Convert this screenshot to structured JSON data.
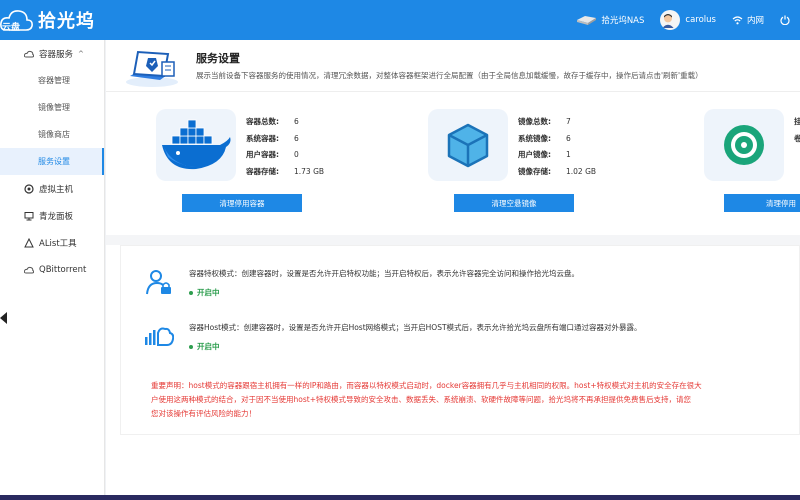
{
  "app": {
    "logo_badge": "云盘",
    "logo_name": "拾光坞"
  },
  "topbar": {
    "device_name": "拾光坞NAS",
    "user_name": "carolus",
    "network": "内网",
    "power_icon": "power-icon"
  },
  "sidebar": {
    "group_label": "容器服务",
    "sub_items": [
      "容器管理",
      "镜像管理",
      "镜像商店",
      "服务设置"
    ],
    "active_index": 3,
    "items": [
      "虚拟主机",
      "青龙面板",
      "AList工具",
      "QBittorrent"
    ]
  },
  "header": {
    "title": "服务设置",
    "description": "展示当前设备下容器服务的使用情况，清理冗余数据，对整体容器框架进行全局配置（由于全局信息加载缓慢，故存于缓存中，操作后请点击'刷新'重载）"
  },
  "stats": {
    "containers": {
      "rows": [
        {
          "label": "容器总数:",
          "value": "6"
        },
        {
          "label": "系统容器:",
          "value": "6"
        },
        {
          "label": "用户容器:",
          "value": "0"
        },
        {
          "label": "容器存储:",
          "value": "1.73 GB"
        }
      ],
      "button": "清理停用容器"
    },
    "images": {
      "rows": [
        {
          "label": "镜像总数:",
          "value": "7"
        },
        {
          "label": "系统镜像:",
          "value": "6"
        },
        {
          "label": "用户镜像:",
          "value": "1"
        },
        {
          "label": "镜像存储:",
          "value": "1.02 GB"
        }
      ],
      "button": "清理空悬镜像"
    },
    "volumes": {
      "rows": [
        {
          "label": "挂",
          "value": ""
        },
        {
          "label": "卷",
          "value": ""
        }
      ],
      "button": "清理停用"
    }
  },
  "modes": {
    "privileged": {
      "text": "容器特权模式：创建容器时，设置是否允许开启特权功能；当开启特权后，表示允许容器完全访问和操作拾光坞云盘。",
      "status": "开启中"
    },
    "host": {
      "text": "容器Host模式：创建容器时，设置是否允许开启Host网络模式；当开启HOST模式后，表示允许拾光坞云盘所有端口通过容器对外暴露。",
      "status": "开启中"
    },
    "warning_lines": [
      "重要声明：host模式的容器跟宿主机拥有一样的IP和路由，而容器以特权模式启动时，docker容器拥有几乎与主机相同的权限。host+特权模式对主机的安全存在很大",
      "户使用这两种模式的结合，对于因不当使用host+特权模式导致的安全攻击、数据丢失、系统崩溃、软硬件故障等问题，拾光坞将不再承担提供免费售后支持，请您",
      "您对该操作有评估风险的能力！"
    ]
  },
  "colors": {
    "primary": "#1e88e5",
    "success": "#2e9e4f",
    "danger": "#e53935"
  }
}
